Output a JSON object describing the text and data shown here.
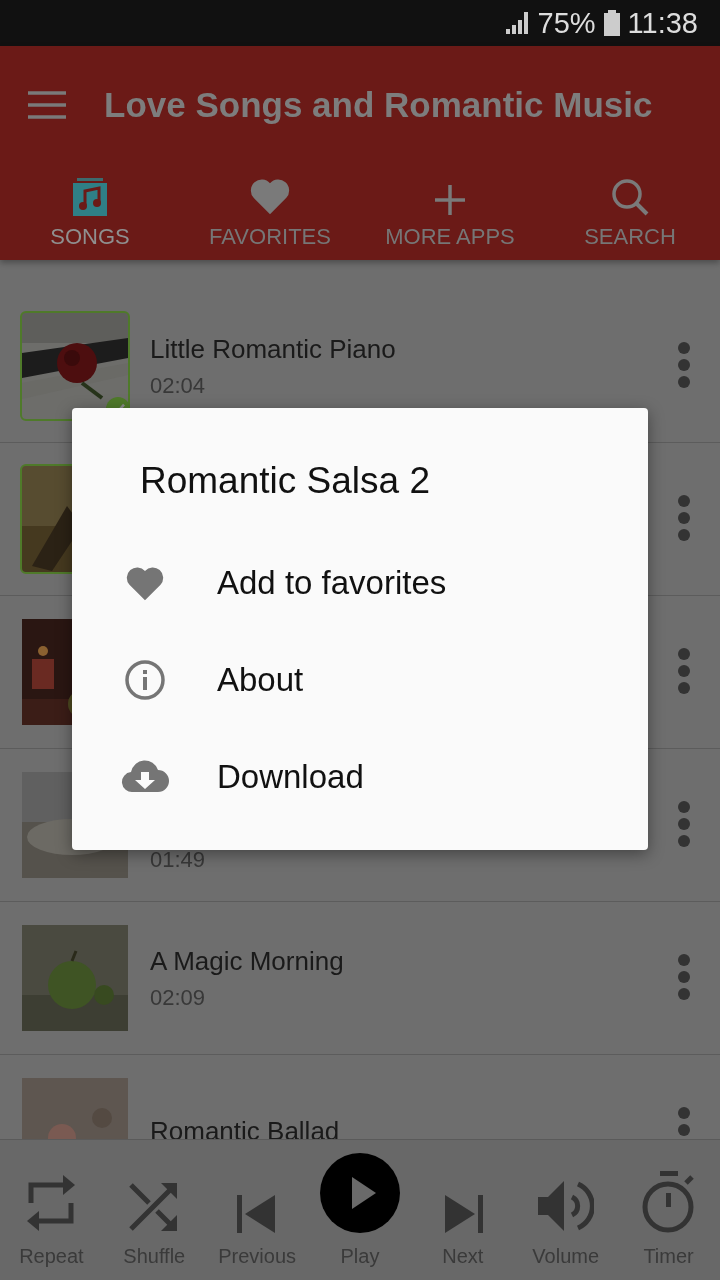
{
  "status_bar": {
    "battery": "75%",
    "time": "11:38"
  },
  "app_bar": {
    "title": "Love Songs and Romantic Music"
  },
  "tabs": [
    {
      "label": "SONGS",
      "selected": true
    },
    {
      "label": "FAVORITES",
      "selected": false
    },
    {
      "label": "MORE APPS",
      "selected": false
    },
    {
      "label": "SEARCH",
      "selected": false
    }
  ],
  "songs": [
    {
      "title": "Little Romantic Piano",
      "duration": "02:04",
      "selected": true,
      "playing": true
    },
    {
      "selected": true,
      "playing": false
    },
    {
      "selected": false,
      "playing": false
    },
    {
      "duration": "01:49",
      "selected": false,
      "playing": false
    },
    {
      "title": "A Magic Morning",
      "duration": "02:09",
      "selected": false,
      "playing": false
    },
    {
      "title": "Romantic Ballad",
      "selected": false,
      "playing": false
    }
  ],
  "dialog": {
    "title": "Romantic Salsa 2",
    "items": [
      {
        "label": "Add to favorites"
      },
      {
        "label": "About"
      },
      {
        "label": "Download"
      }
    ]
  },
  "player": [
    {
      "label": "Repeat"
    },
    {
      "label": "Shuffle"
    },
    {
      "label": "Previous"
    },
    {
      "label": "Play"
    },
    {
      "label": "Next"
    },
    {
      "label": "Volume"
    },
    {
      "label": "Timer"
    }
  ]
}
